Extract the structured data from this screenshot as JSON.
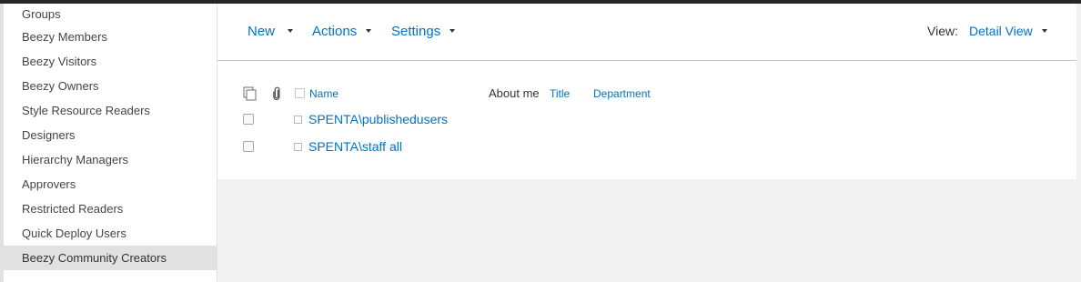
{
  "sidebar": {
    "items": [
      {
        "label": "Groups"
      },
      {
        "label": "Beezy Members"
      },
      {
        "label": "Beezy Visitors"
      },
      {
        "label": "Beezy Owners"
      },
      {
        "label": "Style Resource Readers"
      },
      {
        "label": "Designers"
      },
      {
        "label": "Hierarchy Managers"
      },
      {
        "label": "Approvers"
      },
      {
        "label": "Restricted Readers"
      },
      {
        "label": "Quick Deploy Users"
      },
      {
        "label": "Beezy Community Creators"
      }
    ],
    "selected_index": 10
  },
  "toolbar": {
    "new_label": "New",
    "actions_label": "Actions",
    "settings_label": "Settings",
    "view_label": "View:",
    "view_value": "Detail View"
  },
  "table": {
    "columns": {
      "name": "Name",
      "about_me": "About me",
      "title": "Title",
      "department": "Department"
    },
    "rows": [
      {
        "name": "SPENTA\\publishedusers"
      },
      {
        "name": "SPENTA\\staff all"
      }
    ]
  },
  "colors": {
    "link": "#0072c6",
    "selected_bg": "#e1e1e1",
    "page_bg": "#f2f2f2"
  },
  "icons": {
    "header_docs": "document-stack-icon",
    "header_attach": "paperclip-icon"
  }
}
